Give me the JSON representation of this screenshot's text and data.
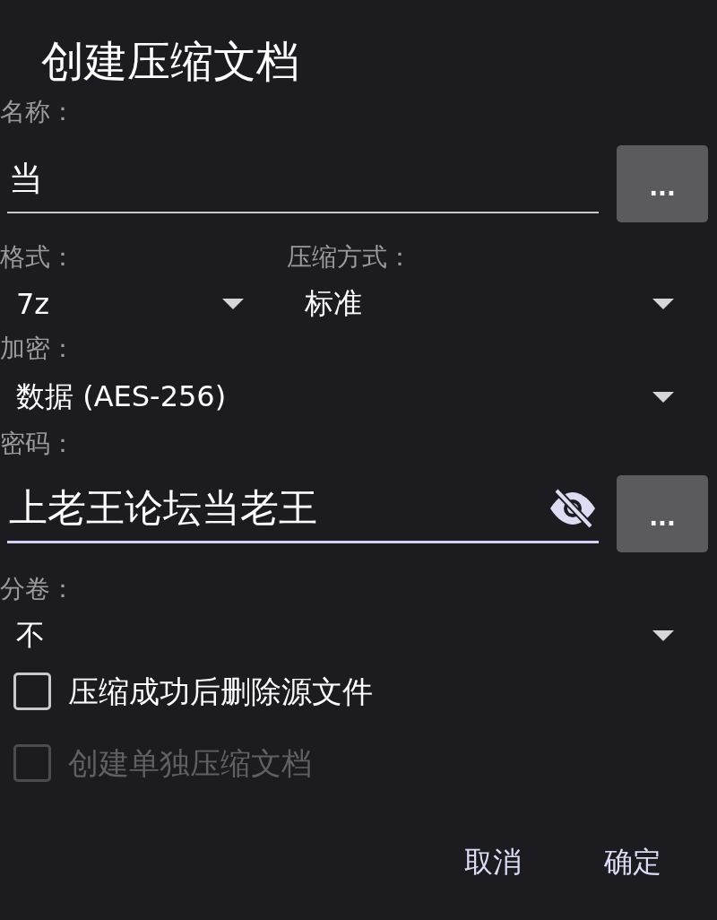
{
  "dialog": {
    "title": "创建压缩文档"
  },
  "name": {
    "label": "名称：",
    "value": "当",
    "focused": false,
    "browse_button": "..."
  },
  "format": {
    "label": "格式：",
    "value": "7z"
  },
  "compression": {
    "label": "压缩方式：",
    "value": "标准"
  },
  "encryption": {
    "label": "加密：",
    "value": "数据 (AES-256)"
  },
  "password": {
    "label": "密码：",
    "value": "上老王论坛当老王",
    "focused": true,
    "browse_button": "..."
  },
  "volumes": {
    "label": "分卷：",
    "value": "不"
  },
  "options": [
    {
      "label": "压缩成功后删除源文件",
      "checked": false,
      "disabled": false
    },
    {
      "label": "创建单独压缩文档",
      "checked": false,
      "disabled": true
    }
  ],
  "buttons": [
    "取消",
    "确定"
  ]
}
